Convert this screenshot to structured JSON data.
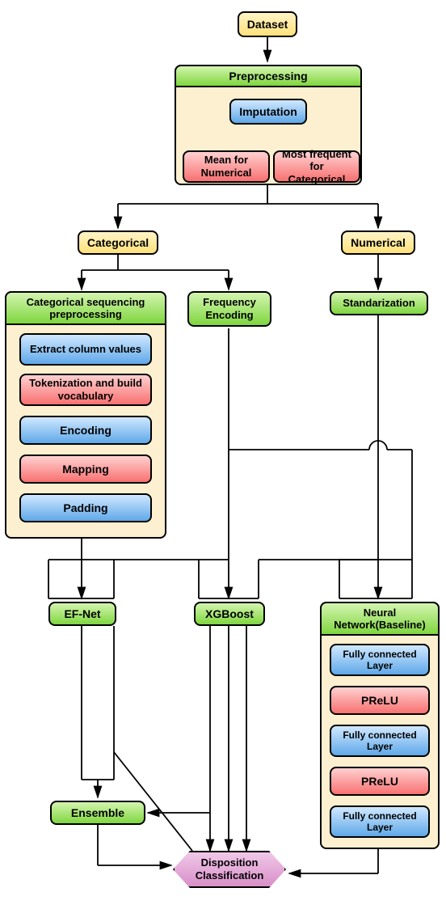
{
  "nodes": {
    "dataset": "Dataset",
    "preprocessing": "Preprocessing",
    "imputation": "Imputation",
    "meanNum": "Mean for Numerical",
    "mostFreq": "Most frequent for Categorical",
    "categorical": "Categorical",
    "numerical": "Numerical",
    "catSeq": "Categorical sequencing preprocessing",
    "freqEnc": "Frequency Encoding",
    "standarization": "Standarization",
    "extractCol": "Extract column values",
    "tokenize": "Tokenization and build vocabulary",
    "encoding": "Encoding",
    "mapping": "Mapping",
    "padding": "Padding",
    "efnet": "EF-Net",
    "xgboost": "XGBoost",
    "nn": "Neural Network(Baseline)",
    "fc1": "Fully connected Layer",
    "prelu1": "PReLU",
    "fc2": "Fully connected Layer",
    "prelu2": "PReLU",
    "fc3": "Fully connected Layer",
    "ensemble": "Ensemble",
    "disp": "Disposition Classification"
  }
}
